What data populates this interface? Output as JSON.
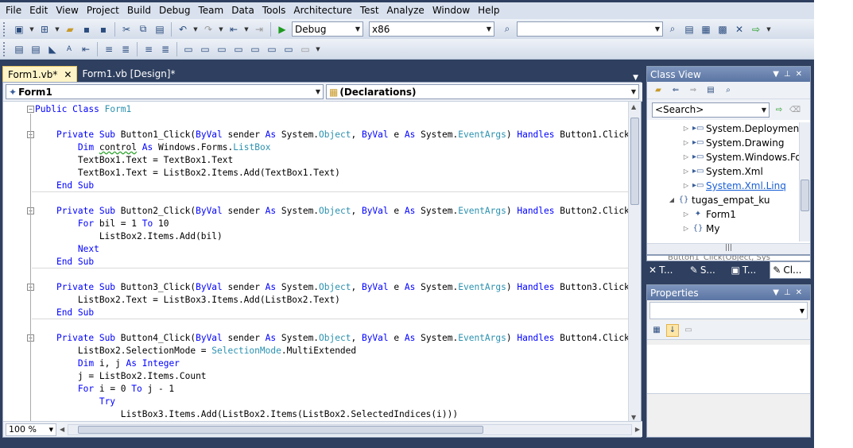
{
  "menu": [
    "File",
    "Edit",
    "View",
    "Project",
    "Build",
    "Debug",
    "Team",
    "Data",
    "Tools",
    "Architecture",
    "Test",
    "Analyze",
    "Window",
    "Help"
  ],
  "toolbar": {
    "config": "Debug",
    "platform": "x86",
    "find_value": ""
  },
  "tabs": [
    {
      "label": "Form1.vb*",
      "close": "✕"
    },
    {
      "label": "Form1.vb [Design]*"
    }
  ],
  "navigation": {
    "class_combo": "Form1",
    "member_combo": "(Declarations)"
  },
  "code_lines": [
    {
      "html": "<span class=\"kw\">Public Class</span> <span class=\"ty\">Form1</span>"
    },
    {
      "html": ""
    },
    {
      "html": "    <span class=\"kw\">Private Sub</span> Button1_Click(<span class=\"kw\">ByVal</span> sender <span class=\"kw\">As</span> System.<span class=\"ty\">Object</span>, <span class=\"kw\">ByVal</span> e <span class=\"kw\">As</span> System.<span class=\"ty\">EventArgs</span>) <span class=\"kw\">Handles</span> Button1.Click"
    },
    {
      "html": "        <span class=\"kw\">Dim</span> <span class=\"squig\">control</span> <span class=\"kw\">As</span> Windows.Forms.<span class=\"ty\">ListBox</span>"
    },
    {
      "html": "        TextBox1.Text = TextBox1.Text"
    },
    {
      "html": "        TextBox1.Text = ListBox2.Items.Add(TextBox1.Text)"
    },
    {
      "html": "    <span class=\"kw\">End Sub</span>"
    },
    {
      "html": ""
    },
    {
      "html": "    <span class=\"kw\">Private Sub</span> Button2_Click(<span class=\"kw\">ByVal</span> sender <span class=\"kw\">As</span> System.<span class=\"ty\">Object</span>, <span class=\"kw\">ByVal</span> e <span class=\"kw\">As</span> System.<span class=\"ty\">EventArgs</span>) <span class=\"kw\">Handles</span> Button2.Click"
    },
    {
      "html": "        <span class=\"kw\">For</span> bil = 1 <span class=\"kw\">To</span> 10"
    },
    {
      "html": "            ListBox2.Items.Add(bil)"
    },
    {
      "html": "        <span class=\"kw\">Next</span>"
    },
    {
      "html": "    <span class=\"kw\">End Sub</span>"
    },
    {
      "html": ""
    },
    {
      "html": "    <span class=\"kw\">Private Sub</span> Button3_Click(<span class=\"kw\">ByVal</span> sender <span class=\"kw\">As</span> System.<span class=\"ty\">Object</span>, <span class=\"kw\">ByVal</span> e <span class=\"kw\">As</span> System.<span class=\"ty\">EventArgs</span>) <span class=\"kw\">Handles</span> Button3.Click"
    },
    {
      "html": "        ListBox2.Text = ListBox3.Items.Add(ListBox2.Text)"
    },
    {
      "html": "    <span class=\"kw\">End Sub</span>"
    },
    {
      "html": ""
    },
    {
      "html": "    <span class=\"kw\">Private Sub</span> Button4_Click(<span class=\"kw\">ByVal</span> sender <span class=\"kw\">As</span> System.<span class=\"ty\">Object</span>, <span class=\"kw\">ByVal</span> e <span class=\"kw\">As</span> System.<span class=\"ty\">EventArgs</span>) <span class=\"kw\">Handles</span> Button4.Click"
    },
    {
      "html": "        ListBox2.SelectionMode = <span class=\"ty\">SelectionMode</span>.MultiExtended"
    },
    {
      "html": "        <span class=\"kw\">Dim</span> i, j <span class=\"kw\">As</span> <span class=\"kw\">Integer</span>"
    },
    {
      "html": "        j = ListBox2.Items.Count"
    },
    {
      "html": "        <span class=\"kw\">For</span> i = 0 <span class=\"kw\">To</span> j - 1"
    },
    {
      "html": "            <span class=\"kw\">Try</span>"
    },
    {
      "html": "                ListBox3.Items.Add(ListBox2.Items(ListBox2.SelectedIndices(i)))"
    }
  ],
  "zoom": "100 %",
  "class_view": {
    "title": "Class View",
    "search_placeholder": "<Search>",
    "tree": [
      {
        "label": "System.Deployment",
        "expander": "▷",
        "icon": "▸▭"
      },
      {
        "label": "System.Drawing",
        "expander": "▷",
        "icon": "▸▭"
      },
      {
        "label": "System.Windows.Forms",
        "expander": "▷",
        "icon": "▸▭"
      },
      {
        "label": "System.Xml",
        "expander": "▷",
        "icon": "▸▭"
      },
      {
        "label": "System.Xml.Linq",
        "expander": "▷",
        "icon": "▸▭",
        "link": true
      },
      {
        "label": "tugas_empat_ku",
        "expander": "◢",
        "icon": "{}"
      },
      {
        "label": "Form1",
        "expander": "▷",
        "icon": "✦"
      },
      {
        "label": "My",
        "expander": "▷",
        "icon": "{}"
      }
    ],
    "members_peek": "Button1_Click(Object, Sys"
  },
  "tool_tabs": [
    {
      "label": "T...",
      "icon": "✕"
    },
    {
      "label": "S...",
      "icon": "✎"
    },
    {
      "label": "T...",
      "icon": "▣"
    },
    {
      "label": "Cl...",
      "icon": "✎",
      "active": true
    }
  ],
  "properties": {
    "title": "Properties"
  }
}
